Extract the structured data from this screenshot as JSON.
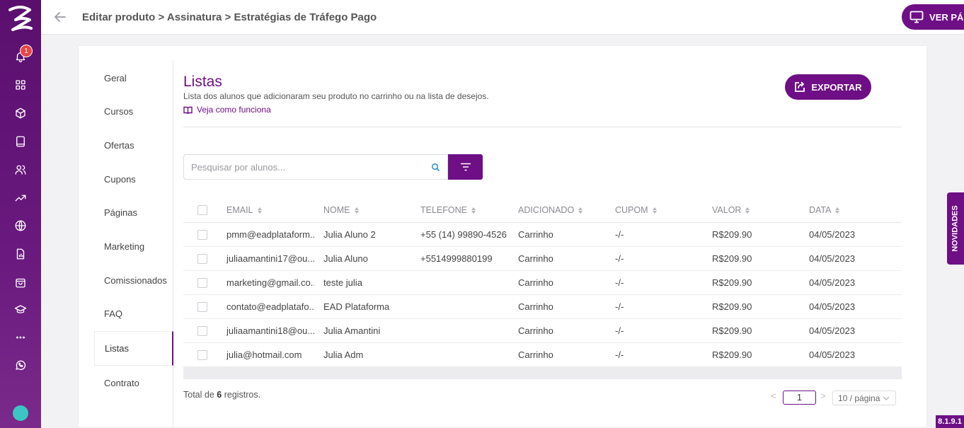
{
  "sidebar": {
    "notification_count": "1",
    "icons": [
      "bell-icon",
      "grid-icon",
      "box-icon",
      "book-icon",
      "users-icon",
      "trending-icon",
      "globe-icon",
      "report-icon",
      "bag-icon",
      "graduation-icon",
      "more-icon",
      "whatsapp-icon"
    ]
  },
  "header": {
    "breadcrumb": "Editar produto > Assinatura > Estratégias de Tráfego Pago",
    "view_page_button": "VER PÁGINA"
  },
  "subnav": {
    "items": [
      {
        "label": "Geral"
      },
      {
        "label": "Cursos"
      },
      {
        "label": "Ofertas"
      },
      {
        "label": "Cupons"
      },
      {
        "label": "Páginas"
      },
      {
        "label": "Marketing"
      },
      {
        "label": "Comissionados"
      },
      {
        "label": "FAQ"
      },
      {
        "label": "Listas"
      },
      {
        "label": "Contrato"
      }
    ],
    "active": "Listas"
  },
  "main": {
    "title": "Listas",
    "subtitle": "Lista dos alunos que adicionaram seu produto no carrinho ou na lista de desejos.",
    "howto_link": "Veja como funciona",
    "export_button": "EXPORTAR",
    "search_placeholder": "Pesquisar por alunos...",
    "search_value": ""
  },
  "table": {
    "columns": [
      "EMAIL",
      "NOME",
      "TELEFONE",
      "ADICIONADO",
      "CUPOM",
      "VALOR",
      "DATA"
    ],
    "rows": [
      {
        "email": "pmm@eadplataform...",
        "nome": "Julia Aluno 2",
        "telefone": "+55 (14) 99890-4526",
        "adicionado": "Carrinho",
        "cupom": "-/-",
        "valor": "R$209.90",
        "data": "04/05/2023"
      },
      {
        "email": "juliaamantini17@ou...",
        "nome": "Julia Aluno",
        "telefone": "+5514999880199",
        "adicionado": "Carrinho",
        "cupom": "-/-",
        "valor": "R$209.90",
        "data": "04/05/2023"
      },
      {
        "email": "marketing@gmail.co...",
        "nome": "teste julia",
        "telefone": "",
        "adicionado": "Carrinho",
        "cupom": "-/-",
        "valor": "R$209.90",
        "data": "04/05/2023"
      },
      {
        "email": "contato@eadplatafo...",
        "nome": "EAD Plataforma",
        "telefone": "",
        "adicionado": "Carrinho",
        "cupom": "-/-",
        "valor": "R$209.90",
        "data": "04/05/2023"
      },
      {
        "email": "juliaamantini18@ou...",
        "nome": "Julia Amantini",
        "telefone": "",
        "adicionado": "Carrinho",
        "cupom": "-/-",
        "valor": "R$209.90",
        "data": "04/05/2023"
      },
      {
        "email": "julia@hotmail.com",
        "nome": "Julia Adm",
        "telefone": "",
        "adicionado": "Carrinho",
        "cupom": "-/-",
        "valor": "R$209.90",
        "data": "04/05/2023"
      }
    ]
  },
  "footer": {
    "total_prefix": "Total de",
    "total_count": "6",
    "total_suffix": "registros.",
    "prev": "<",
    "next": ">",
    "current_page": "1",
    "page_size": "10 / página"
  },
  "novidades_tab": "NOVIDADES",
  "version": "8.1.9.1",
  "colors": {
    "brand": "#6e0f86",
    "sidebar": "#5a0f6e",
    "badge": "#e84545"
  }
}
